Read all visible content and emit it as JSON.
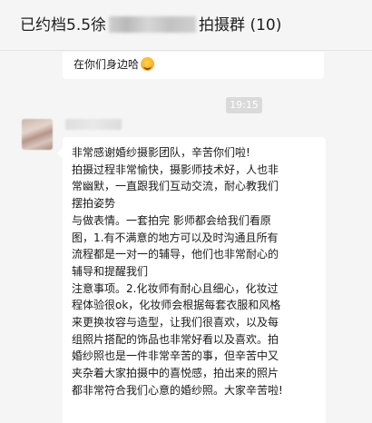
{
  "window": {
    "title_prefix": "已约档5.5徐",
    "title_suffix": "拍摄群 (10)"
  },
  "previous_message": {
    "text": "在你们身边哈",
    "emoji": "smiling-face-icon"
  },
  "timestamp": "19:15",
  "message": {
    "lines": [
      "非常感谢婚纱摄影团队，辛苦你们啦!",
      "拍摄过程非常愉快，摄影师技术好，人也非",
      "常幽默，一直跟我们互动交流，耐心教我们",
      "摆拍姿势",
      "与做表情。一套拍完 影师都会给我们看原",
      "图，1.有不满意的地方可以及时沟通且所有",
      "流程都是一对一的辅导，他们也非常耐心的",
      "辅导和提醒我们",
      "注意事项。2.化妆师有耐心且细心，化妆过",
      "程体验很ok，化妆师会根据每套衣服和风格",
      "来更换妆容与造型，让我们很喜欢，以及每",
      "组照片搭配的饰品也非常好看以及喜欢。拍",
      "婚纱照也是一件非常辛苦的事，但辛苦中又",
      "夹杂着大家拍摄中的喜悦感，拍出来的照片",
      "都非常符合我们心意的婚纱照。大家辛苦啦!"
    ]
  }
}
